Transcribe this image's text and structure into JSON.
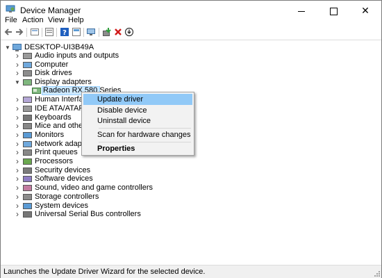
{
  "window": {
    "title": "Device Manager",
    "icon": "device-manager-icon"
  },
  "window_controls": {
    "minimize": "minimize-icon",
    "maximize": "maximize-icon",
    "close": "✕"
  },
  "menu": {
    "items": [
      "File",
      "Action",
      "View",
      "Help"
    ]
  },
  "toolbar": {
    "buttons": [
      "back-icon",
      "forward-icon",
      "properties-icon",
      "show-hidden-icon",
      "help-icon",
      "show-tree-icon",
      "monitor-icon",
      "update-driver-icon",
      "uninstall-icon",
      "scan-icon"
    ]
  },
  "tree": {
    "root": "DESKTOP-UI3B49A",
    "categories": [
      {
        "label": "Audio inputs and outputs",
        "icon": "speaker-icon"
      },
      {
        "label": "Computer",
        "icon": "computer-icon"
      },
      {
        "label": "Disk drives",
        "icon": "disk-icon"
      },
      {
        "label": "Display adapters",
        "icon": "display-adapter-icon",
        "expanded": true
      },
      {
        "label": "Human Interface I",
        "icon": "hid-icon"
      },
      {
        "label": "IDE ATA/ATAPI co",
        "icon": "ide-icon"
      },
      {
        "label": "Keyboards",
        "icon": "keyboard-icon"
      },
      {
        "label": "Mice and other po",
        "icon": "mouse-icon"
      },
      {
        "label": "Monitors",
        "icon": "monitor-icon"
      },
      {
        "label": "Network adapters",
        "icon": "network-icon"
      },
      {
        "label": "Print queues",
        "icon": "printer-icon"
      },
      {
        "label": "Processors",
        "icon": "processor-icon"
      },
      {
        "label": "Security devices",
        "icon": "security-icon"
      },
      {
        "label": "Software devices",
        "icon": "software-icon"
      },
      {
        "label": "Sound, video and game controllers",
        "icon": "sound-icon"
      },
      {
        "label": "Storage controllers",
        "icon": "storage-icon"
      },
      {
        "label": "System devices",
        "icon": "system-icon"
      },
      {
        "label": "Universal Serial Bus controllers",
        "icon": "usb-icon"
      }
    ],
    "selected_child": "Radeon RX 580 Series"
  },
  "context_menu": {
    "items": [
      "Update driver",
      "Disable device",
      "Uninstall device",
      "Scan for hardware changes",
      "Properties"
    ],
    "highlighted": "Update driver"
  },
  "status": {
    "text": "Launches the Update Driver Wizard for the selected device."
  },
  "colors": {
    "selection": "#cce8ff",
    "menu_highlight": "#91c9f7",
    "menu_bg": "#f2f2f2"
  }
}
